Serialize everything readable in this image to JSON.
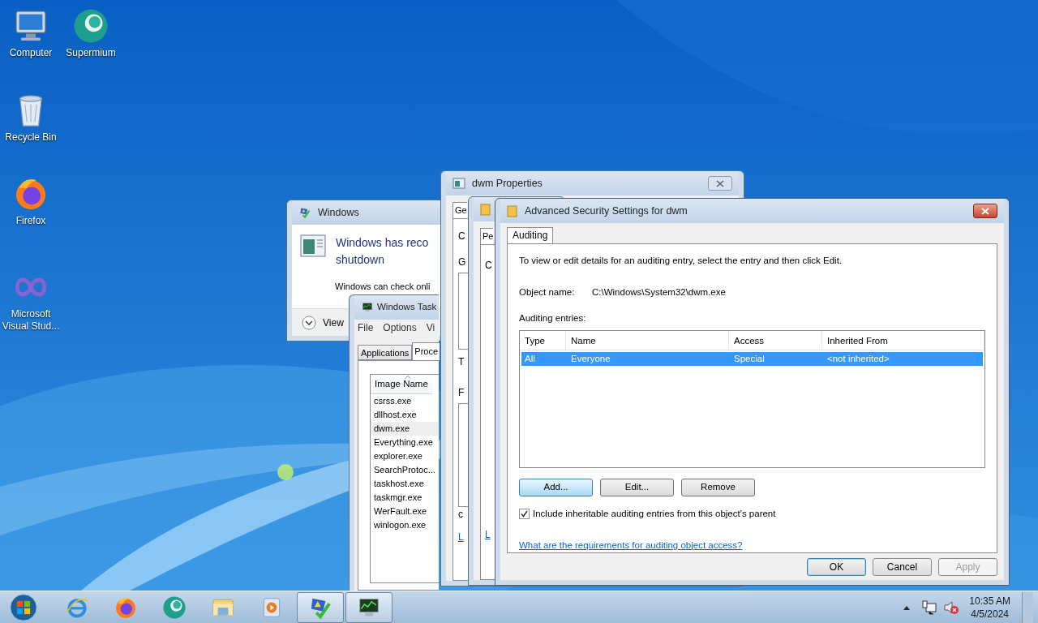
{
  "desktop_icons": [
    {
      "label": "Computer",
      "kind": "computer"
    },
    {
      "label": "Supermium",
      "kind": "supermium"
    },
    {
      "label": "Recycle Bin",
      "kind": "recycle"
    },
    {
      "label": "Firefox",
      "kind": "firefox"
    },
    {
      "label": "Microsoft Visual Stud...",
      "kind": "vs"
    }
  ],
  "error_window": {
    "title": "Windows",
    "heading_lines": [
      "Windows has reco",
      "shutdown"
    ],
    "body": "Windows can check onli",
    "footer": "View"
  },
  "task_manager": {
    "title": "Windows Task",
    "menu": [
      "File",
      "Options",
      "Vi"
    ],
    "tabs": [
      {
        "label": "Applications",
        "selected": false
      },
      {
        "label": "Proce",
        "selected": true
      }
    ],
    "column": "Image Name",
    "processes": [
      {
        "name": "csrss.exe",
        "selected": false
      },
      {
        "name": "dllhost.exe",
        "selected": false
      },
      {
        "name": "dwm.exe",
        "selected": true
      },
      {
        "name": "Everything.exe",
        "selected": false
      },
      {
        "name": "explorer.exe",
        "selected": false
      },
      {
        "name": "SearchProtoc...",
        "selected": false
      },
      {
        "name": "taskhost.exe",
        "selected": false
      },
      {
        "name": "taskmgr.exe",
        "selected": false
      },
      {
        "name": "WerFault.exe",
        "selected": false
      },
      {
        "name": "winlogon.exe",
        "selected": false
      }
    ]
  },
  "properties_window": {
    "title": "dwm Properties",
    "tab": "Ge",
    "labels": [
      "C",
      "G",
      "T",
      "F",
      "c"
    ],
    "link": "L"
  },
  "permissions_window": {
    "tab": "Pe",
    "label": "C",
    "link": "L"
  },
  "advanced_window": {
    "title": "Advanced Security Settings for dwm",
    "tabs": [
      {
        "label": "Auditing",
        "selected": true
      }
    ],
    "instruction": "To view or edit details for an auditing entry, select the entry and then click Edit.",
    "object_name_label": "Object name:",
    "object_name_value": "C:\\Windows\\System32\\dwm.exe",
    "entries_label": "Auditing entries:",
    "columns": [
      "Type",
      "Name",
      "Access",
      "Inherited From"
    ],
    "rows": [
      {
        "cells": [
          "All",
          "Everyone",
          "Special",
          "<not inherited>"
        ],
        "selected": true
      }
    ],
    "entry_buttons": [
      {
        "label": "Add...",
        "hovered": true
      },
      {
        "label": "Edit...",
        "hovered": false
      },
      {
        "label": "Remove",
        "hovered": false
      }
    ],
    "include_inheritable": {
      "label": "Include inheritable auditing entries from this object's parent",
      "checked": true
    },
    "help_link": "What are the requirements for auditing object access?",
    "dialog_buttons": [
      {
        "label": "OK",
        "default": true,
        "disabled": false
      },
      {
        "label": "Cancel",
        "default": false,
        "disabled": false
      },
      {
        "label": "Apply",
        "default": false,
        "disabled": true
      }
    ]
  },
  "taskbar": {
    "items": [
      {
        "kind": "start",
        "open": false
      },
      {
        "kind": "ie",
        "open": false
      },
      {
        "kind": "firefox",
        "open": false
      },
      {
        "kind": "supermium",
        "open": false
      },
      {
        "kind": "explorer",
        "open": false
      },
      {
        "kind": "media",
        "open": false
      },
      {
        "kind": "action_center",
        "open": true
      },
      {
        "kind": "task_manager",
        "open": true
      }
    ],
    "time": "10:35 AM",
    "date": "4/5/2024"
  }
}
